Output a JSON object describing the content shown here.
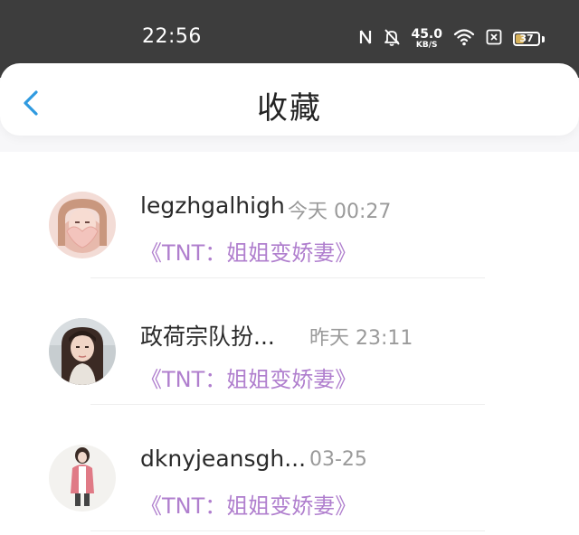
{
  "status_bar": {
    "time": "22:56",
    "net_speed_value": "45.0",
    "net_speed_unit": "KB/S",
    "battery_level": "37",
    "icons": [
      "nfc-icon",
      "bell-muted-icon",
      "wifi-icon",
      "no-sim-icon",
      "battery-icon"
    ]
  },
  "header": {
    "title": "收藏",
    "back_icon": "chevron-left-icon",
    "accent_color": "#2f9ae0"
  },
  "favorites": [
    {
      "name": "legzhgalhigh",
      "time": "今天 00:27",
      "book": "《TNT：姐姐变娇妻》"
    },
    {
      "name": "政荷宗队扮...",
      "time": "昨天 23:11",
      "book": "《TNT：姐姐变娇妻》"
    },
    {
      "name": "dknyjeansgh...",
      "time": "03-25",
      "book": "《TNT：姐姐变娇妻》"
    }
  ],
  "colors": {
    "status_bar_bg": "#3d3d3d",
    "book_title": "#b07fce",
    "timestamp": "#9a9a9a"
  }
}
